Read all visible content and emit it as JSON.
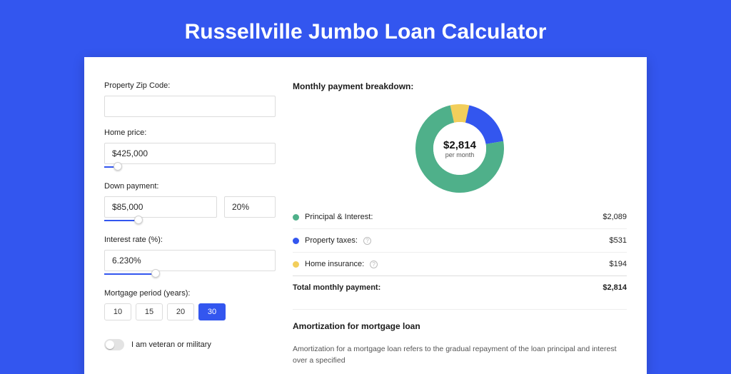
{
  "title": "Russellville Jumbo Loan Calculator",
  "colors": {
    "principal": "#4fb08a",
    "taxes": "#3356ef",
    "insurance": "#f2ce5b"
  },
  "form": {
    "zip": {
      "label": "Property Zip Code:",
      "value": ""
    },
    "price": {
      "label": "Home price:",
      "value": "$425,000",
      "pct": 8
    },
    "down": {
      "label": "Down payment:",
      "value": "$85,000",
      "pct_value": "20%",
      "pct": 20
    },
    "rate": {
      "label": "Interest rate (%):",
      "value": "6.230%",
      "pct": 30
    },
    "period": {
      "label": "Mortgage period (years):",
      "options": [
        "10",
        "15",
        "20",
        "30"
      ],
      "active": 3
    },
    "veteran": {
      "label": "I am veteran or military"
    }
  },
  "breakdown": {
    "title": "Monthly payment breakdown:",
    "amount": "$2,814",
    "sub": "per month",
    "items": [
      {
        "label": "Principal & Interest:",
        "value": "$2,089",
        "share": 74.2,
        "help": false
      },
      {
        "label": "Property taxes:",
        "value": "$531",
        "share": 18.9,
        "help": true
      },
      {
        "label": "Home insurance:",
        "value": "$194",
        "share": 6.9,
        "help": true
      }
    ],
    "total_label": "Total monthly payment:",
    "total_value": "$2,814"
  },
  "amort": {
    "title": "Amortization for mortgage loan",
    "body": "Amortization for a mortgage loan refers to the gradual repayment of the loan principal and interest over a specified"
  },
  "chart_data": {
    "type": "pie",
    "title": "Monthly payment breakdown",
    "categories": [
      "Principal & Interest",
      "Property taxes",
      "Home insurance"
    ],
    "values": [
      2089,
      531,
      194
    ],
    "colors": [
      "#4fb08a",
      "#3356ef",
      "#f2ce5b"
    ],
    "center_label": "$2,814 per month"
  }
}
